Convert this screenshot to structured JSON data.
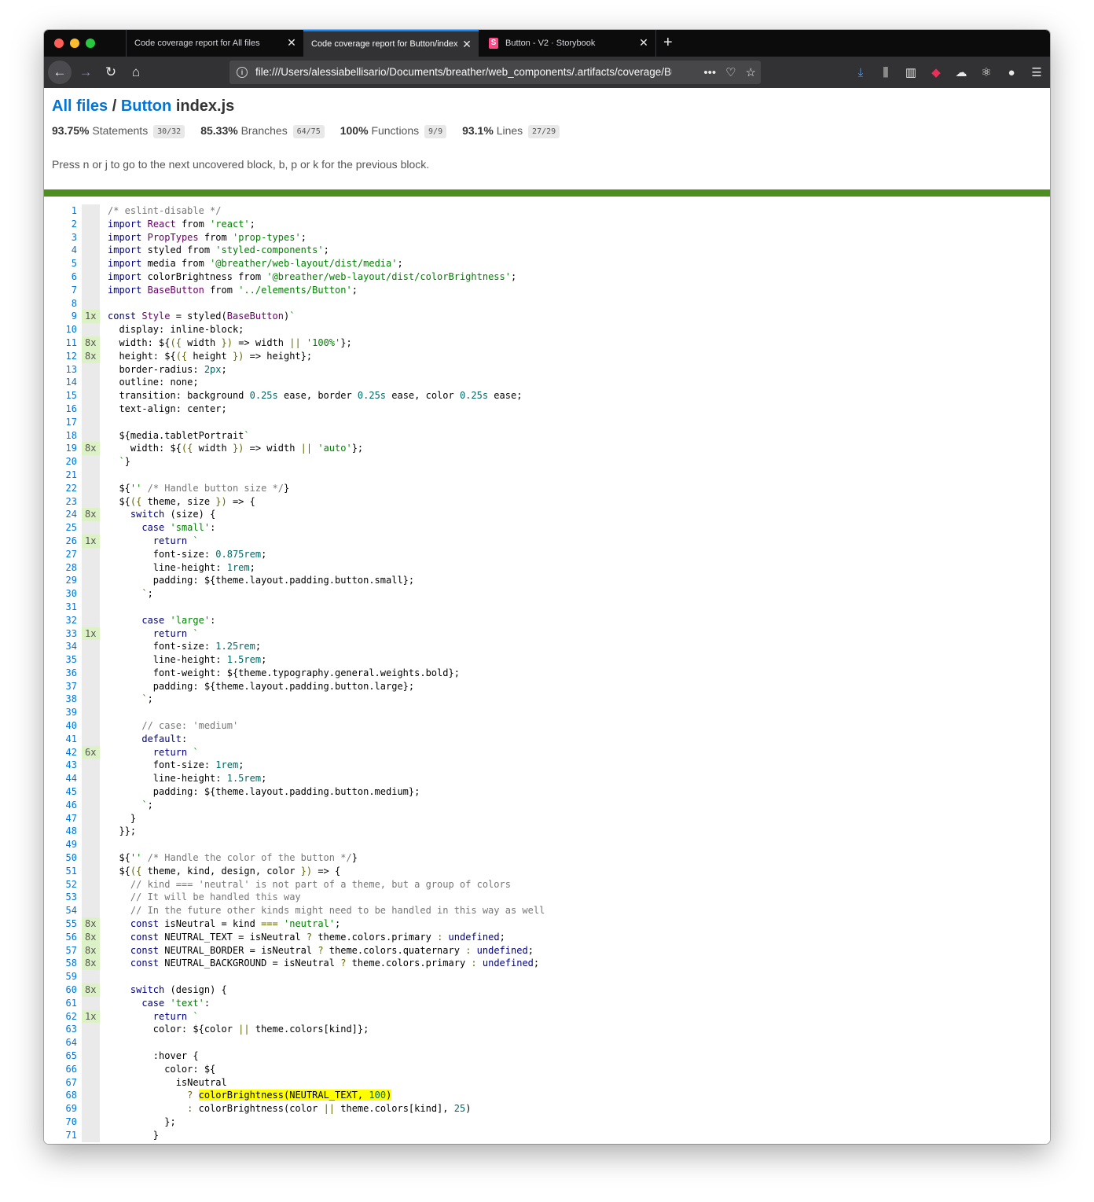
{
  "browser": {
    "tabs": [
      {
        "title": "Code coverage report for All files",
        "active": false
      },
      {
        "title": "Code coverage report for Button/index.js",
        "active": true
      },
      {
        "title": "Button - V2 · Storybook",
        "active": false
      }
    ],
    "url": "file:///Users/alessiabellisario/Documents/breather/web_components/.artifacts/coverage/Button/index.js.html"
  },
  "breadcrumb": {
    "all_files": "All files",
    "sep": "/",
    "folder": "Button",
    "file": "index.js"
  },
  "stats": [
    {
      "pct": "93.75%",
      "label": "Statements",
      "fraction": "30/32"
    },
    {
      "pct": "85.33%",
      "label": "Branches",
      "fraction": "64/75"
    },
    {
      "pct": "100%",
      "label": "Functions",
      "fraction": "9/9"
    },
    {
      "pct": "93.1%",
      "label": "Lines",
      "fraction": "27/29"
    }
  ],
  "hint": "Press n or j to go to the next uncovered block, b, p or k for the previous block.",
  "colors": {
    "status_bar": "#4d8f1f",
    "highlight": "#ffff00",
    "link": "#0074d9"
  },
  "code_lines": [
    {
      "n": "1",
      "hits": "",
      "html": "<span class=\"c\">/* eslint-disable */</span>"
    },
    {
      "n": "2",
      "hits": "",
      "html": "<span class=\"k\">import</span> <span class=\"v\">React</span> from <span class=\"s\">'react'</span>;"
    },
    {
      "n": "3",
      "hits": "",
      "html": "<span class=\"k\">import</span> <span class=\"v\">PropTypes</span> from <span class=\"s\">'prop-types'</span>;"
    },
    {
      "n": "4",
      "hits": "",
      "html": "<span class=\"k\">import</span> styled from <span class=\"s\">'styled-components'</span>;"
    },
    {
      "n": "5",
      "hits": "",
      "html": "<span class=\"k\">import</span> media from <span class=\"s\">'@breather/web-layout/dist/media'</span>;"
    },
    {
      "n": "6",
      "hits": "",
      "html": "<span class=\"k\">import</span> colorBrightness from <span class=\"s\">'@breather/web-layout/dist/colorBrightness'</span>;"
    },
    {
      "n": "7",
      "hits": "",
      "html": "<span class=\"k\">import</span> <span class=\"v\">BaseButton</span> from <span class=\"s\">'../elements/Button'</span>;"
    },
    {
      "n": "8",
      "hits": "",
      "html": ""
    },
    {
      "n": "9",
      "hits": "1x",
      "html": "<span class=\"k\">const</span> <span class=\"v\">Style</span> = styled(<span class=\"v\">BaseButton</span>)<span class=\"s\">`</span>"
    },
    {
      "n": "10",
      "hits": "",
      "html": "  display: inline-block;"
    },
    {
      "n": "11",
      "hits": "8x",
      "html": "  width: ${<span class=\"o\">({</span> width <span class=\"o\">})</span> =&gt; width <span class=\"o\">||</span> <span class=\"s\">'100%'</span>};"
    },
    {
      "n": "12",
      "hits": "8x",
      "html": "  height: ${<span class=\"o\">({</span> height <span class=\"o\">})</span> =&gt; height};"
    },
    {
      "n": "13",
      "hits": "",
      "html": "  border-radius: <span class=\"n\">2px</span>;"
    },
    {
      "n": "14",
      "hits": "",
      "html": "  outline: none;"
    },
    {
      "n": "15",
      "hits": "",
      "html": "  transition: background <span class=\"n\">0.25s</span> ease, border <span class=\"n\">0.25s</span> ease, color <span class=\"n\">0.25s</span> ease;"
    },
    {
      "n": "16",
      "hits": "",
      "html": "  text-align: center;"
    },
    {
      "n": "17",
      "hits": "",
      "html": ""
    },
    {
      "n": "18",
      "hits": "",
      "html": "  ${media.tabletPortrait<span class=\"s\">`</span>"
    },
    {
      "n": "19",
      "hits": "8x",
      "html": "    width: ${<span class=\"o\">({</span> width <span class=\"o\">})</span> =&gt; width <span class=\"o\">||</span> <span class=\"s\">'auto'</span>};"
    },
    {
      "n": "20",
      "hits": "",
      "html": "  <span class=\"s\">`</span>}"
    },
    {
      "n": "21",
      "hits": "",
      "html": ""
    },
    {
      "n": "22",
      "hits": "",
      "html": "  ${<span class=\"s\">''</span> <span class=\"c\">/* Handle button size */</span>}"
    },
    {
      "n": "23",
      "hits": "",
      "html": "  ${<span class=\"o\">({</span> theme, size <span class=\"o\">})</span> =&gt; {"
    },
    {
      "n": "24",
      "hits": "8x",
      "html": "    <span class=\"k\">switch</span> (size) {"
    },
    {
      "n": "25",
      "hits": "",
      "html": "      <span class=\"k\">case</span> <span class=\"s\">'small'</span>:"
    },
    {
      "n": "26",
      "hits": "1x",
      "html": "        <span class=\"k\">return</span> <span class=\"s\">`</span>"
    },
    {
      "n": "27",
      "hits": "",
      "html": "        font-size: <span class=\"n\">0.875rem</span>;"
    },
    {
      "n": "28",
      "hits": "",
      "html": "        line-height: <span class=\"n\">1rem</span>;"
    },
    {
      "n": "29",
      "hits": "",
      "html": "        padding: ${theme.layout.padding.button.small};"
    },
    {
      "n": "30",
      "hits": "",
      "html": "      <span class=\"s\">`</span>;"
    },
    {
      "n": "31",
      "hits": "",
      "html": ""
    },
    {
      "n": "32",
      "hits": "",
      "html": "      <span class=\"k\">case</span> <span class=\"s\">'large'</span>:"
    },
    {
      "n": "33",
      "hits": "1x",
      "html": "        <span class=\"k\">return</span> <span class=\"s\">`</span>"
    },
    {
      "n": "34",
      "hits": "",
      "html": "        font-size: <span class=\"n\">1.25rem</span>;"
    },
    {
      "n": "35",
      "hits": "",
      "html": "        line-height: <span class=\"n\">1.5rem</span>;"
    },
    {
      "n": "36",
      "hits": "",
      "html": "        font-weight: ${theme.typography.general.weights.bold};"
    },
    {
      "n": "37",
      "hits": "",
      "html": "        padding: ${theme.layout.padding.button.large};"
    },
    {
      "n": "38",
      "hits": "",
      "html": "      <span class=\"s\">`</span>;"
    },
    {
      "n": "39",
      "hits": "",
      "html": ""
    },
    {
      "n": "40",
      "hits": "",
      "html": "      <span class=\"c\">// case: 'medium'</span>"
    },
    {
      "n": "41",
      "hits": "",
      "html": "      <span class=\"k\">default</span>:"
    },
    {
      "n": "42",
      "hits": "6x",
      "html": "        <span class=\"k\">return</span> <span class=\"s\">`</span>"
    },
    {
      "n": "43",
      "hits": "",
      "html": "        font-size: <span class=\"n\">1rem</span>;"
    },
    {
      "n": "44",
      "hits": "",
      "html": "        line-height: <span class=\"n\">1.5rem</span>;"
    },
    {
      "n": "45",
      "hits": "",
      "html": "        padding: ${theme.layout.padding.button.medium};"
    },
    {
      "n": "46",
      "hits": "",
      "html": "      <span class=\"s\">`</span>;"
    },
    {
      "n": "47",
      "hits": "",
      "html": "    }"
    },
    {
      "n": "48",
      "hits": "",
      "html": "  }};"
    },
    {
      "n": "49",
      "hits": "",
      "html": ""
    },
    {
      "n": "50",
      "hits": "",
      "html": "  ${<span class=\"s\">''</span> <span class=\"c\">/* Handle the color of the button */</span>}"
    },
    {
      "n": "51",
      "hits": "",
      "html": "  ${<span class=\"o\">({</span> theme, kind, design, color <span class=\"o\">})</span> =&gt; {"
    },
    {
      "n": "52",
      "hits": "",
      "html": "    <span class=\"c\">// kind === 'neutral' is not part of a theme, but a group of colors</span>"
    },
    {
      "n": "53",
      "hits": "",
      "html": "    <span class=\"c\">// It will be handled this way</span>"
    },
    {
      "n": "54",
      "hits": "",
      "html": "    <span class=\"c\">// In the future other kinds might need to be handled in this way as well</span>"
    },
    {
      "n": "55",
      "hits": "8x",
      "html": "    <span class=\"k\">const</span> isNeutral = kind <span class=\"o\">===</span> <span class=\"s\">'neutral'</span>;"
    },
    {
      "n": "56",
      "hits": "8x",
      "html": "    <span class=\"k\">const</span> NEUTRAL_TEXT = isNeutral <span class=\"o\">?</span> theme.colors.primary <span class=\"o\">:</span> <span class=\"k\">undefined</span>;"
    },
    {
      "n": "57",
      "hits": "8x",
      "html": "    <span class=\"k\">const</span> NEUTRAL_BORDER = isNeutral <span class=\"o\">?</span> theme.colors.quaternary <span class=\"o\">:</span> <span class=\"k\">undefined</span>;"
    },
    {
      "n": "58",
      "hits": "8x",
      "html": "    <span class=\"k\">const</span> NEUTRAL_BACKGROUND = isNeutral <span class=\"o\">?</span> theme.colors.primary <span class=\"o\">:</span> <span class=\"k\">undefined</span>;"
    },
    {
      "n": "59",
      "hits": "",
      "html": ""
    },
    {
      "n": "60",
      "hits": "8x",
      "html": "    <span class=\"k\">switch</span> (design) {"
    },
    {
      "n": "61",
      "hits": "",
      "html": "      <span class=\"k\">case</span> <span class=\"s\">'text'</span>:"
    },
    {
      "n": "62",
      "hits": "1x",
      "html": "        <span class=\"k\">return</span> <span class=\"s\">`</span>"
    },
    {
      "n": "63",
      "hits": "",
      "html": "        color: ${color <span class=\"o\">||</span> theme.colors[kind]};"
    },
    {
      "n": "64",
      "hits": "",
      "html": ""
    },
    {
      "n": "65",
      "hits": "",
      "html": "        :hover {"
    },
    {
      "n": "66",
      "hits": "",
      "html": "          color: ${"
    },
    {
      "n": "67",
      "hits": "",
      "html": "            isNeutral"
    },
    {
      "n": "68",
      "hits": "",
      "html": "              <span class=\"o\">?</span> <span class=\"hl\">colorBrightness(NEUTRAL_TEXT, <span class=\"n\">100</span>)</span>"
    },
    {
      "n": "69",
      "hits": "",
      "html": "              <span class=\"o\">:</span> colorBrightness(color <span class=\"o\">||</span> theme.colors[kind], <span class=\"n\">25</span>)"
    },
    {
      "n": "70",
      "hits": "",
      "html": "          };"
    },
    {
      "n": "71",
      "hits": "",
      "html": "        }"
    }
  ]
}
